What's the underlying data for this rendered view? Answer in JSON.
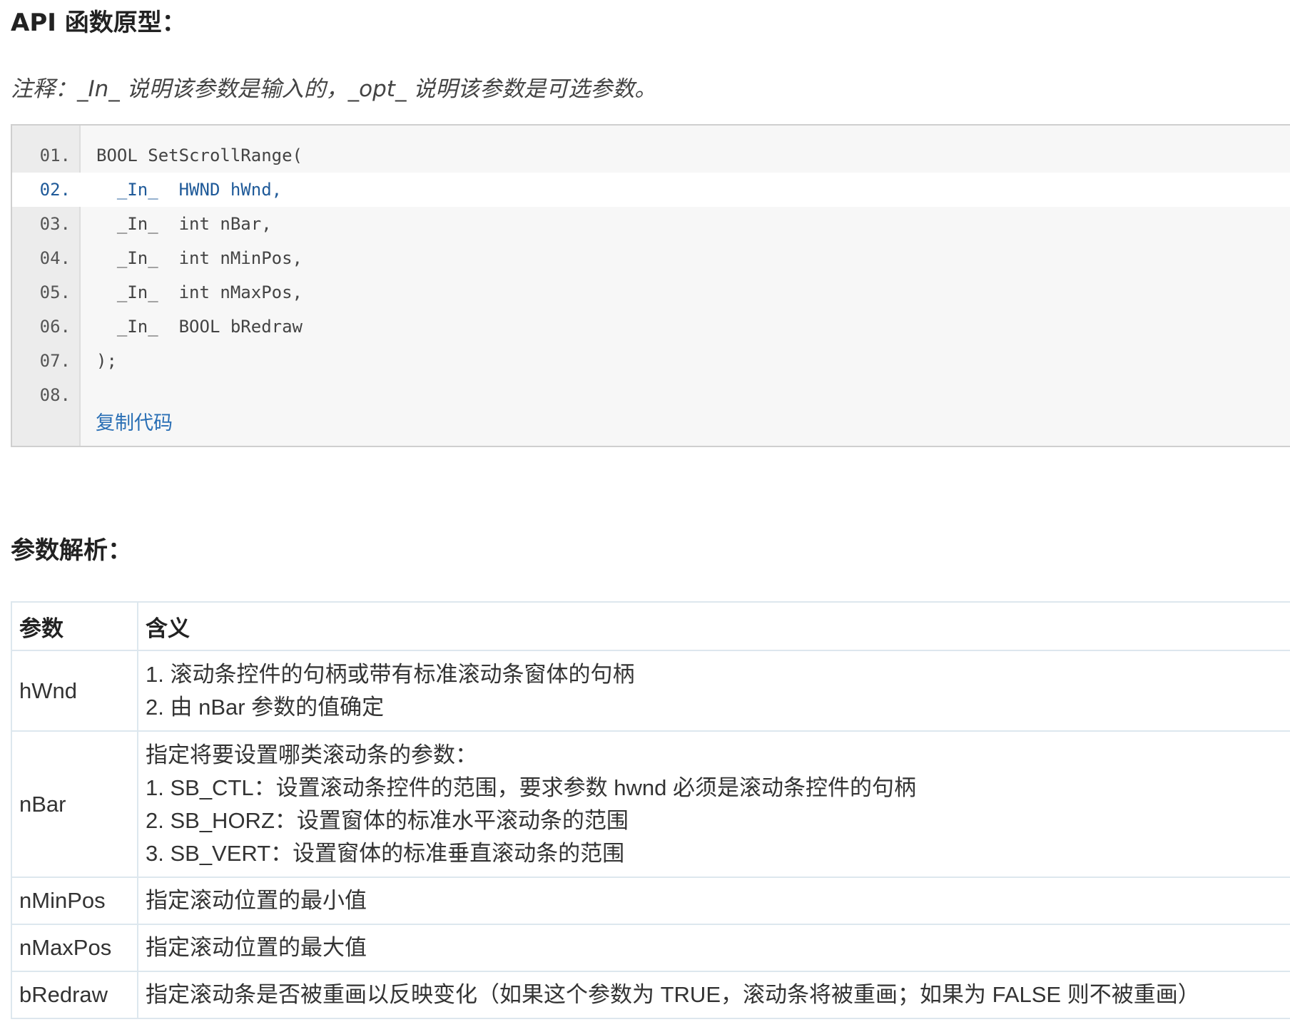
{
  "heading_api": "API 函数原型：",
  "note": "注释：_In_ 说明该参数是输入的，_opt_ 说明该参数是可选参数。",
  "code": {
    "lines": [
      {
        "num": "01.",
        "text": "BOOL SetScrollRange("
      },
      {
        "num": "02.",
        "text": "  _In_  HWND hWnd,"
      },
      {
        "num": "03.",
        "text": "  _In_  int nBar,"
      },
      {
        "num": "04.",
        "text": "  _In_  int nMinPos,"
      },
      {
        "num": "05.",
        "text": "  _In_  int nMaxPos,"
      },
      {
        "num": "06.",
        "text": "  _In_  BOOL bRedraw"
      },
      {
        "num": "07.",
        "text": ");"
      },
      {
        "num": "08.",
        "text": ""
      }
    ],
    "copy_label": "复制代码"
  },
  "heading_params": "参数解析：",
  "table": {
    "headers": [
      "参数",
      "含义"
    ],
    "rows": [
      {
        "param": "hWnd",
        "meaning": [
          "1. 滚动条控件的句柄或带有标准滚动条窗体的句柄",
          "2. 由 nBar 参数的值确定"
        ]
      },
      {
        "param": "nBar",
        "meaning": [
          "指定将要设置哪类滚动条的参数：",
          "1. SB_CTL：设置滚动条控件的范围，要求参数 hwnd 必须是滚动条控件的句柄",
          "2. SB_HORZ：设置窗体的标准水平滚动条的范围",
          "3. SB_VERT：设置窗体的标准垂直滚动条的范围"
        ]
      },
      {
        "param": "nMinPos",
        "meaning": [
          "指定滚动位置的最小值"
        ]
      },
      {
        "param": "nMaxPos",
        "meaning": [
          "指定滚动位置的最大值"
        ]
      },
      {
        "param": "bRedraw",
        "meaning": [
          "指定滚动条是否被重画以反映变化（如果这个参数为 TRUE，滚动条将被重画；如果为 FALSE 则不被重画）"
        ]
      }
    ]
  }
}
